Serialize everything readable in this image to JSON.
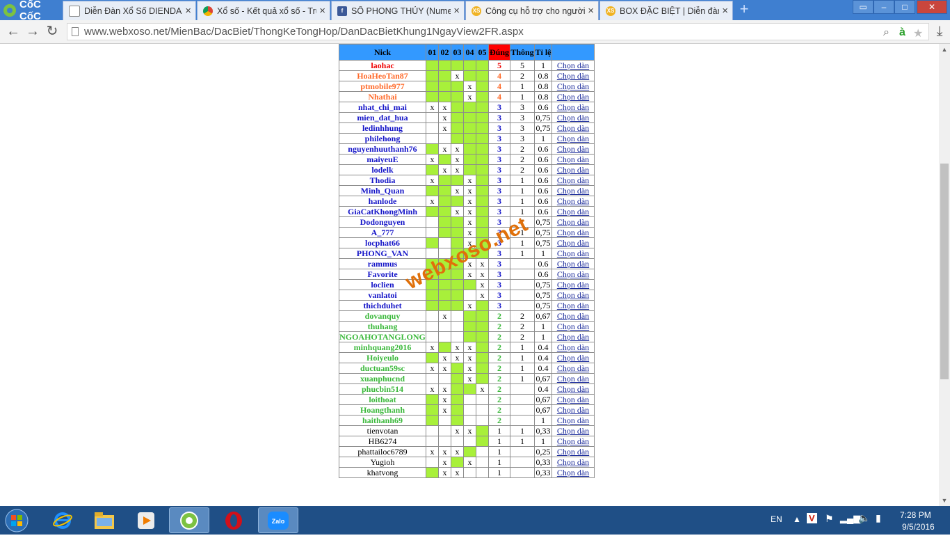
{
  "browser": {
    "brand": "CốC CốC",
    "tabs": [
      {
        "title": "Diễn Đàn Xổ Số DIENDAN",
        "icon": "page-icon",
        "active": false
      },
      {
        "title": "Xổ số - Kết quả xổ số - Trự",
        "icon": "chrome-icon",
        "active": false
      },
      {
        "title": "SỐ PHONG THỦY (Numero",
        "icon": "facebook-icon",
        "active": false
      },
      {
        "title": "Công cụ hỗ trợ cho người",
        "icon": "xs-icon",
        "active": true
      },
      {
        "title": "BOX ĐẶC BIỆT | Diễn đàn",
        "icon": "xs-icon",
        "active": false
      }
    ],
    "url": "www.webxoso.net/MienBac/DacBiet/ThongKeTongHop/DanDacBietKhung1NgayView2FR.aspx"
  },
  "table": {
    "headers": [
      "Nick",
      "01",
      "02",
      "03",
      "04",
      "05",
      "Đúng",
      "Thông",
      "Tỉ lệ",
      ""
    ],
    "link_label": "Chọn dàn",
    "rows": [
      {
        "nick": "laohac",
        "tier": 5,
        "d": [
          "g",
          "g",
          "g",
          "g",
          "g"
        ],
        "dung": "5",
        "thong": "5",
        "tile": "1"
      },
      {
        "nick": "HoaHeoTan87",
        "tier": 4,
        "d": [
          "g",
          "g",
          "x",
          "g",
          "g"
        ],
        "dung": "4",
        "thong": "2",
        "tile": "0.8"
      },
      {
        "nick": "ptmobile977",
        "tier": 4,
        "d": [
          "g",
          "g",
          "g",
          "x",
          "g"
        ],
        "dung": "4",
        "thong": "1",
        "tile": "0.8"
      },
      {
        "nick": "Nhathai",
        "tier": 4,
        "d": [
          "g",
          "g",
          "g",
          "x",
          "g"
        ],
        "dung": "4",
        "thong": "1",
        "tile": "0.8"
      },
      {
        "nick": "nhat_chi_mai",
        "tier": 3,
        "d": [
          "x",
          "x",
          "g",
          "g",
          "g"
        ],
        "dung": "3",
        "thong": "3",
        "tile": "0.6"
      },
      {
        "nick": "mien_dat_hua",
        "tier": 3,
        "d": [
          "",
          "x",
          "g",
          "g",
          "g"
        ],
        "dung": "3",
        "thong": "3",
        "tile": "0,75"
      },
      {
        "nick": "ledinhhung",
        "tier": 3,
        "d": [
          "",
          "x",
          "g",
          "g",
          "g"
        ],
        "dung": "3",
        "thong": "3",
        "tile": "0,75"
      },
      {
        "nick": "philehong",
        "tier": 3,
        "d": [
          "",
          "",
          "g",
          "g",
          "g"
        ],
        "dung": "3",
        "thong": "3",
        "tile": "1"
      },
      {
        "nick": "nguyenhuuthanh76",
        "tier": 3,
        "d": [
          "g",
          "x",
          "x",
          "g",
          "g"
        ],
        "dung": "3",
        "thong": "2",
        "tile": "0.6"
      },
      {
        "nick": "maiyeuE",
        "tier": 3,
        "d": [
          "x",
          "g",
          "x",
          "g",
          "g"
        ],
        "dung": "3",
        "thong": "2",
        "tile": "0.6"
      },
      {
        "nick": "lodelk",
        "tier": 3,
        "d": [
          "g",
          "x",
          "x",
          "g",
          "g"
        ],
        "dung": "3",
        "thong": "2",
        "tile": "0.6"
      },
      {
        "nick": "Thodia",
        "tier": 3,
        "d": [
          "x",
          "g",
          "g",
          "x",
          "g"
        ],
        "dung": "3",
        "thong": "1",
        "tile": "0.6"
      },
      {
        "nick": "Minh_Quan",
        "tier": 3,
        "d": [
          "g",
          "g",
          "x",
          "x",
          "g"
        ],
        "dung": "3",
        "thong": "1",
        "tile": "0.6"
      },
      {
        "nick": "hanlode",
        "tier": 3,
        "d": [
          "x",
          "g",
          "g",
          "x",
          "g"
        ],
        "dung": "3",
        "thong": "1",
        "tile": "0.6"
      },
      {
        "nick": "GiaCatKhongMinh",
        "tier": 3,
        "d": [
          "g",
          "g",
          "x",
          "x",
          "g"
        ],
        "dung": "3",
        "thong": "1",
        "tile": "0.6"
      },
      {
        "nick": "Dodonguyen",
        "tier": 3,
        "d": [
          "",
          "g",
          "g",
          "x",
          "g"
        ],
        "dung": "3",
        "thong": "1",
        "tile": "0,75"
      },
      {
        "nick": "A_777",
        "tier": 3,
        "d": [
          "",
          "g",
          "g",
          "x",
          "g"
        ],
        "dung": "3",
        "thong": "1",
        "tile": "0,75"
      },
      {
        "nick": "locphat66",
        "tier": 3,
        "d": [
          "g",
          "",
          "g",
          "x",
          "g"
        ],
        "dung": "3",
        "thong": "1",
        "tile": "0,75"
      },
      {
        "nick": "PHONG_VAN",
        "tier": 3,
        "d": [
          "",
          "",
          "g",
          "g",
          "g"
        ],
        "dung": "3",
        "thong": "1",
        "tile": "1"
      },
      {
        "nick": "rammus",
        "tier": 3,
        "d": [
          "g",
          "g",
          "g",
          "x",
          "x"
        ],
        "dung": "3",
        "thong": "",
        "tile": "0.6"
      },
      {
        "nick": "Favorite",
        "tier": 3,
        "d": [
          "g",
          "g",
          "g",
          "x",
          "x"
        ],
        "dung": "3",
        "thong": "",
        "tile": "0.6"
      },
      {
        "nick": "loclien",
        "tier": 3,
        "d": [
          "g",
          "g",
          "g",
          "g",
          "x"
        ],
        "dung": "3",
        "thong": "",
        "tile": "0,75"
      },
      {
        "nick": "vanlatoi",
        "tier": 3,
        "d": [
          "g",
          "g",
          "g",
          "",
          "x"
        ],
        "dung": "3",
        "thong": "",
        "tile": "0,75"
      },
      {
        "nick": "thichduhet",
        "tier": 3,
        "d": [
          "g",
          "g",
          "g",
          "x",
          "g"
        ],
        "dung": "3",
        "thong": "",
        "tile": "0,75"
      },
      {
        "nick": "dovanquy",
        "tier": 2,
        "d": [
          "",
          "x",
          "",
          "g",
          "g"
        ],
        "dung": "2",
        "thong": "2",
        "tile": "0,67"
      },
      {
        "nick": "thuhang",
        "tier": 2,
        "d": [
          "",
          "",
          "",
          "g",
          "g"
        ],
        "dung": "2",
        "thong": "2",
        "tile": "1"
      },
      {
        "nick": "NGOAHOTANGLONG",
        "tier": 2,
        "d": [
          "",
          "",
          "",
          "g",
          "g"
        ],
        "dung": "2",
        "thong": "2",
        "tile": "1"
      },
      {
        "nick": "minhquang2016",
        "tier": 2,
        "d": [
          "x",
          "g",
          "x",
          "x",
          "g"
        ],
        "dung": "2",
        "thong": "1",
        "tile": "0.4"
      },
      {
        "nick": "Hoiyeulo",
        "tier": 2,
        "d": [
          "g",
          "x",
          "x",
          "x",
          "g"
        ],
        "dung": "2",
        "thong": "1",
        "tile": "0.4"
      },
      {
        "nick": "ductuan59sc",
        "tier": 2,
        "d": [
          "x",
          "x",
          "g",
          "x",
          "g"
        ],
        "dung": "2",
        "thong": "1",
        "tile": "0.4"
      },
      {
        "nick": "xuanphucnd",
        "tier": 2,
        "d": [
          "",
          "",
          "g",
          "x",
          "g"
        ],
        "dung": "2",
        "thong": "1",
        "tile": "0,67"
      },
      {
        "nick": "phucbin514",
        "tier": 2,
        "d": [
          "x",
          "x",
          "g",
          "g",
          "x"
        ],
        "dung": "2",
        "thong": "",
        "tile": "0.4"
      },
      {
        "nick": "loithoat",
        "tier": 2,
        "d": [
          "g",
          "x",
          "g",
          "",
          ""
        ],
        "dung": "2",
        "thong": "",
        "tile": "0,67"
      },
      {
        "nick": "Hoangthanh",
        "tier": 2,
        "d": [
          "g",
          "x",
          "g",
          "",
          ""
        ],
        "dung": "2",
        "thong": "",
        "tile": "0,67"
      },
      {
        "nick": "haithanh69",
        "tier": 2,
        "d": [
          "g",
          "",
          "g",
          "",
          ""
        ],
        "dung": "2",
        "thong": "",
        "tile": "1"
      },
      {
        "nick": "tienvotan",
        "tier": 1,
        "d": [
          "",
          "",
          "x",
          "x",
          "g"
        ],
        "dung": "1",
        "thong": "1",
        "tile": "0,33"
      },
      {
        "nick": "HB6274",
        "tier": 1,
        "d": [
          "",
          "",
          "",
          "",
          "g"
        ],
        "dung": "1",
        "thong": "1",
        "tile": "1"
      },
      {
        "nick": "phattailoc6789",
        "tier": 1,
        "d": [
          "x",
          "x",
          "x",
          "g",
          ""
        ],
        "dung": "1",
        "thong": "",
        "tile": "0,25"
      },
      {
        "nick": "Yugioh",
        "tier": 1,
        "d": [
          "",
          "x",
          "g",
          "x",
          ""
        ],
        "dung": "1",
        "thong": "",
        "tile": "0,33"
      },
      {
        "nick": "khatvong",
        "tier": 1,
        "d": [
          "g",
          "x",
          "x",
          "",
          ""
        ],
        "dung": "1",
        "thong": "",
        "tile": "0,33"
      }
    ]
  },
  "watermark": "webxoso.net",
  "taskbar": {
    "lang": "EN",
    "time": "7:28 PM",
    "date": "9/5/2016",
    "apps": [
      "windows-start-icon",
      "internet-explorer-icon",
      "file-explorer-icon",
      "media-player-icon",
      "coccoc-icon",
      "opera-icon",
      "zalo-icon"
    ],
    "zalo_label": "Zalo"
  }
}
